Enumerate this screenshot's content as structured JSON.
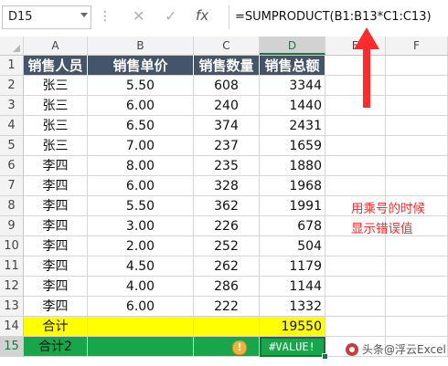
{
  "namebox": {
    "value": "D15"
  },
  "formula_bar": {
    "formula": "=SUMPRODUCT(B1:B13*C1:C13)",
    "cancel_label": "✕",
    "enter_label": "✓",
    "fx_label": "fx"
  },
  "columns": [
    "A",
    "B",
    "C",
    "D",
    "E",
    "F"
  ],
  "rows": [
    "1",
    "2",
    "3",
    "4",
    "5",
    "6",
    "7",
    "8",
    "9",
    "10",
    "11",
    "12",
    "13",
    "14",
    "15"
  ],
  "table": {
    "headers": [
      "销售人员",
      "销售单价",
      "销售数量",
      "销售总额"
    ],
    "data": [
      [
        "张三",
        "5.50",
        "608",
        "3344"
      ],
      [
        "张三",
        "6.00",
        "240",
        "1440"
      ],
      [
        "张三",
        "6.50",
        "374",
        "2431"
      ],
      [
        "张三",
        "7.00",
        "237",
        "1659"
      ],
      [
        "李四",
        "8.00",
        "235",
        "1880"
      ],
      [
        "李四",
        "6.00",
        "328",
        "1968"
      ],
      [
        "李四",
        "5.50",
        "362",
        "1991"
      ],
      [
        "李四",
        "3.00",
        "226",
        "678"
      ],
      [
        "李四",
        "2.00",
        "252",
        "504"
      ],
      [
        "李四",
        "4.50",
        "262",
        "1179"
      ],
      [
        "李四",
        "4.00",
        "286",
        "1144"
      ],
      [
        "李四",
        "6.00",
        "222",
        "1332"
      ]
    ],
    "total_row": {
      "label": "合计",
      "value": "19550"
    },
    "total2_row": {
      "label": "合计2",
      "value": "#VALUE!"
    }
  },
  "annotation": {
    "line1": "用乘号的时候",
    "line2": "显示错误值"
  },
  "watermark": {
    "text": "头条@浮云Excel"
  },
  "colors": {
    "header_bg": "#44546a",
    "total_bg": "#ffff00",
    "total2_bg": "#18a64a",
    "annotation": "#ff2a2a",
    "arrow": "#ff2a2a"
  },
  "icons": {
    "warning": "warning-icon",
    "arrow": "red-up-arrow"
  }
}
